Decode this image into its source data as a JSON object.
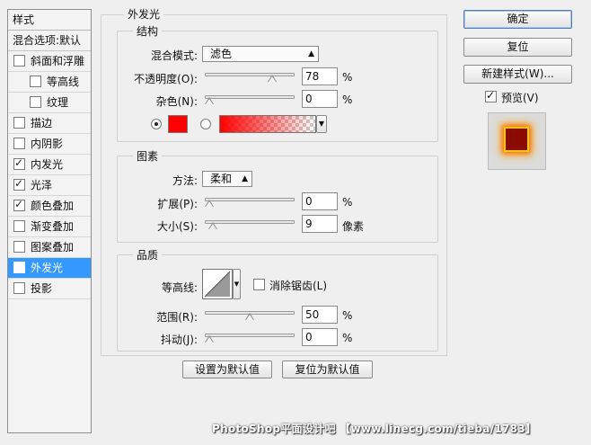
{
  "sidebar": {
    "header": "样式",
    "blend_options": "混合选项:默认",
    "items": [
      {
        "label": "斜面和浮雕",
        "checked": false,
        "sub": false,
        "active": false
      },
      {
        "label": "等高线",
        "checked": false,
        "sub": true,
        "active": false
      },
      {
        "label": "纹理",
        "checked": false,
        "sub": true,
        "active": false
      },
      {
        "label": "描边",
        "checked": false,
        "sub": false,
        "active": false
      },
      {
        "label": "内阴影",
        "checked": false,
        "sub": false,
        "active": false
      },
      {
        "label": "内发光",
        "checked": true,
        "sub": false,
        "active": false
      },
      {
        "label": "光泽",
        "checked": true,
        "sub": false,
        "active": false
      },
      {
        "label": "颜色叠加",
        "checked": true,
        "sub": false,
        "active": false
      },
      {
        "label": "渐变叠加",
        "checked": false,
        "sub": false,
        "active": false
      },
      {
        "label": "图案叠加",
        "checked": false,
        "sub": false,
        "active": false
      },
      {
        "label": "外发光",
        "checked": true,
        "sub": false,
        "active": true
      },
      {
        "label": "投影",
        "checked": false,
        "sub": false,
        "active": false
      }
    ],
    "check_glyph": "✓"
  },
  "panel": {
    "title": "外发光",
    "structure": {
      "title": "结构",
      "blend_mode_label": "混合模式:",
      "blend_mode_value": "滤色",
      "opacity_label": "不透明度(O):",
      "opacity_value": "78",
      "opacity_level": 78,
      "opacity_unit": "%",
      "noise_label": "杂色(N):",
      "noise_value": "0",
      "noise_level": 0,
      "noise_unit": "%",
      "color": "#ff0000"
    },
    "elements": {
      "title": "图素",
      "method_label": "方法:",
      "method_value": "柔和",
      "spread_label": "扩展(P):",
      "spread_value": "0",
      "spread_level": 0,
      "spread_unit": "%",
      "size_label": "大小(S):",
      "size_value": "9",
      "size_level": 4,
      "size_unit": "像素"
    },
    "quality": {
      "title": "品质",
      "contour_label": "等高线:",
      "antialias_label": "消除锯齿(L)",
      "range_label": "范围(R):",
      "range_value": "50",
      "range_level": 50,
      "range_unit": "%",
      "jitter_label": "抖动(J):",
      "jitter_value": "0",
      "jitter_level": 0,
      "jitter_unit": "%"
    },
    "set_default_label": "设置为默认值",
    "reset_default_label": "复位为默认值"
  },
  "actions": {
    "ok_label": "确定",
    "reset_label": "复位",
    "new_style_label": "新建样式(W)...",
    "preview_label": "预览(V)",
    "preview_checked": true
  },
  "watermark": "PhotoShop平面设计吧 【www.linecg.com/tieba/1783】"
}
